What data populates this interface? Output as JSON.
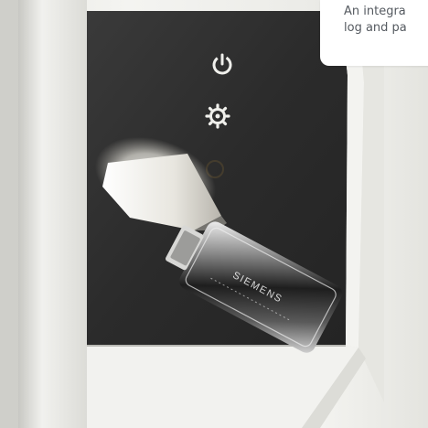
{
  "caption": {
    "text": "An integra\nlog and pa"
  },
  "device": {
    "panel_color": "#2b2b2b",
    "icons": [
      "power-icon",
      "settings-gear-icon",
      "circle-icon"
    ],
    "icon_glow_color": "#f2f2ee"
  },
  "usb_key": {
    "engraving": "SIEMENS"
  }
}
